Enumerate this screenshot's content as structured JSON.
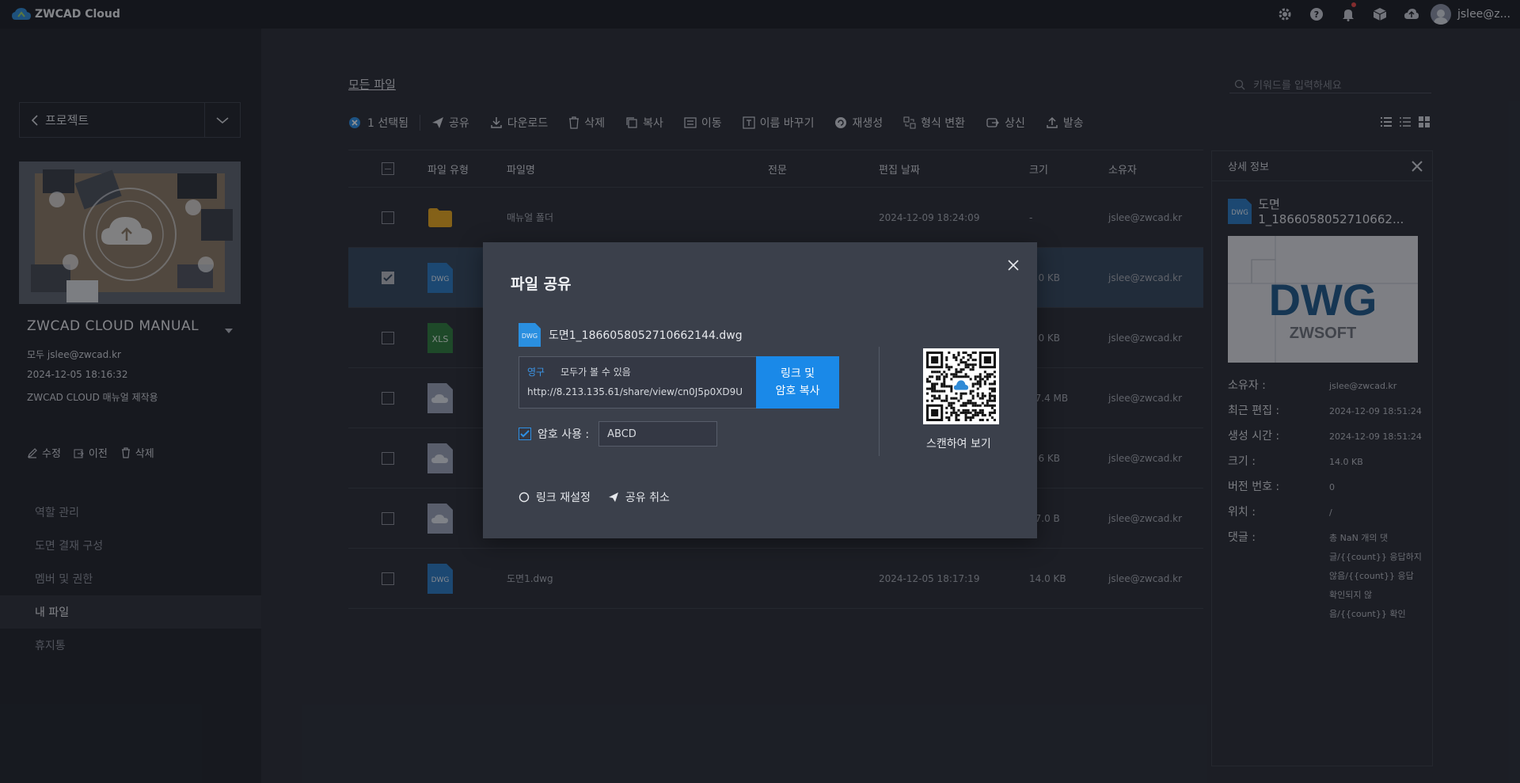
{
  "app": {
    "logo_text": "ZWCAD Cloud",
    "user_name": "jslee@z..."
  },
  "sidebar": {
    "project_select_label": "프로젝트",
    "project_name": "ZWCAD CLOUD MANUAL",
    "owner_line": "모두 jslee@zwcad.kr",
    "created": "2024-12-05 18:16:32",
    "description": "ZWCAD CLOUD 매뉴얼 제작용",
    "actions": {
      "edit": "수정",
      "transfer": "이전",
      "delete": "삭제"
    },
    "nav": [
      {
        "label": "역할 관리"
      },
      {
        "label": "도면 결재 구성"
      },
      {
        "label": "멤버 및 권한"
      },
      {
        "label": "내 파일"
      },
      {
        "label": "휴지통"
      }
    ]
  },
  "main": {
    "breadcrumb": "모든 파일",
    "search_placeholder": "키워드를 입력하세요",
    "toolbar": {
      "selected": "1 선택됨",
      "share": "공유",
      "download": "다운로드",
      "delete": "삭제",
      "copy": "복사",
      "move": "이동",
      "rename": "이름 바꾸기",
      "regenerate": "재생성",
      "convert": "형식 변환",
      "upload": "상신",
      "send": "발송"
    },
    "columns": {
      "type": "파일 유형",
      "name": "파일명",
      "spec": "전문",
      "date": "편집 날짜",
      "size": "크기",
      "owner": "소유자"
    },
    "rows": [
      {
        "icon": "folder",
        "name": "매뉴얼 폴더",
        "date": "2024-12-09 18:24:09",
        "size": "-",
        "owner": "jslee@zwcad.kr",
        "checked": false
      },
      {
        "icon": "dwg",
        "name": "",
        "date": "",
        "size": "4.0 KB",
        "owner": "jslee@zwcad.kr",
        "checked": true
      },
      {
        "icon": "xls",
        "name": "",
        "date": "",
        "size": "7.0 KB",
        "owner": "jslee@zwcad.kr",
        "checked": false
      },
      {
        "icon": "cloud-file",
        "name": "",
        "date": "",
        "size": "17.4 MB",
        "owner": "jslee@zwcad.kr",
        "checked": false
      },
      {
        "icon": "cloud-file",
        "name": "",
        "date": "",
        "size": "7.6 KB",
        "owner": "jslee@zwcad.kr",
        "checked": false
      },
      {
        "icon": "cloud-file",
        "name": "",
        "date": "",
        "size": "97.0 B",
        "owner": "jslee@zwcad.kr",
        "checked": false
      },
      {
        "icon": "dwg",
        "name": "도면1.dwg",
        "date": "2024-12-05 18:17:19",
        "size": "14.0 KB",
        "owner": "jslee@zwcad.kr",
        "checked": false
      }
    ]
  },
  "detail": {
    "title": "상세 정보",
    "file_name": "도면1_1866058052710662...",
    "preview_big": "DWG",
    "preview_small": "ZWSOFT",
    "fields": [
      {
        "k": "소유자 :",
        "v": "jslee@zwcad.kr"
      },
      {
        "k": "최근 편집 :",
        "v": "2024-12-09 18:51:24"
      },
      {
        "k": "생성 시간 :",
        "v": "2024-12-09 18:51:24"
      },
      {
        "k": "크기 :",
        "v": "14.0 KB"
      },
      {
        "k": "버전 번호 :",
        "v": "0"
      },
      {
        "k": "위치 :",
        "v": "/"
      },
      {
        "k": "댓글 :",
        "v": "총 NaN 개의 댓글/{{count}} 응답하지 않음/{{count}} 응답 확인되지 않음/{{count}} 확인"
      }
    ]
  },
  "modal": {
    "title": "파일 공유",
    "file_name": "도면1_1866058052710662144.dwg",
    "permanence": "영구",
    "visibility": "모두가 볼 수 있음",
    "url": "http://8.213.135.61/share/view/cn0J5p0XD9U",
    "copy_line1": "링크 및",
    "copy_line2": "암호 복사",
    "password_label": "암호 사용 :",
    "password_value": "ABCD",
    "scan_label": "스캔하여 보기",
    "reset_link": "링크 재설정",
    "cancel_share": "공유 취소"
  },
  "colors": {
    "accent": "#1a89e8",
    "dwg": "#2a7bc4",
    "xls": "#2e7d3e",
    "folder": "#e8a820"
  }
}
